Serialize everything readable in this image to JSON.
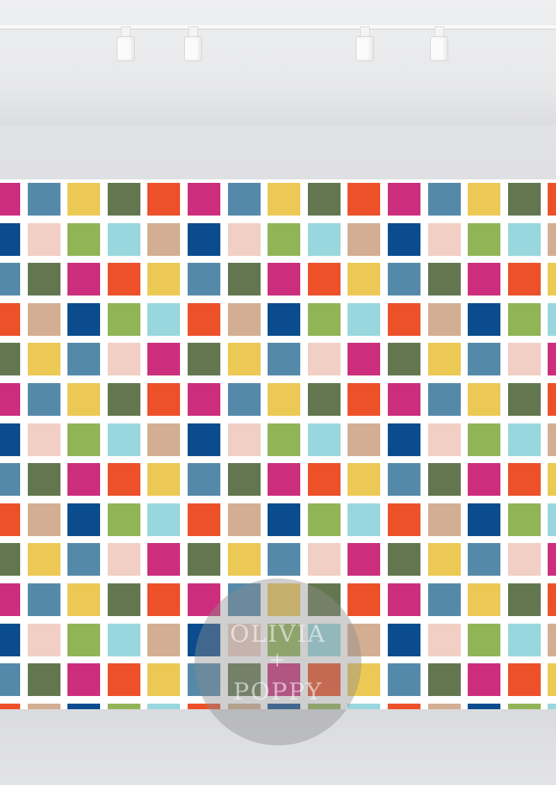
{
  "scene": "gallery-wall-with-wallpaper",
  "colors": {
    "magenta": "#cc2e7d",
    "steel_blue": "#5589aa",
    "yellow": "#ecc955",
    "moss_green": "#62774f",
    "orange": "#ec5129",
    "navy": "#0b4c8f",
    "blush": "#f1cfc4",
    "lime": "#91b457",
    "aqua": "#98d7de",
    "tan": "#d3ae92"
  },
  "pattern": {
    "name": "multicolor-square-grid",
    "rows": [
      [
        "magenta",
        "steel_blue",
        "yellow",
        "moss_green",
        "orange",
        "magenta",
        "steel_blue",
        "yellow",
        "moss_green",
        "orange",
        "magenta",
        "steel_blue",
        "yellow",
        "moss_green",
        "orange"
      ],
      [
        "navy",
        "blush",
        "lime",
        "aqua",
        "tan",
        "navy",
        "blush",
        "lime",
        "aqua",
        "tan",
        "navy",
        "blush",
        "lime",
        "aqua",
        "tan"
      ],
      [
        "steel_blue",
        "moss_green",
        "magenta",
        "orange",
        "yellow",
        "steel_blue",
        "moss_green",
        "magenta",
        "orange",
        "yellow",
        "steel_blue",
        "moss_green",
        "magenta",
        "orange",
        "yellow"
      ],
      [
        "orange",
        "tan",
        "navy",
        "lime",
        "aqua",
        "orange",
        "tan",
        "navy",
        "lime",
        "aqua",
        "orange",
        "tan",
        "navy",
        "lime",
        "aqua"
      ],
      [
        "moss_green",
        "yellow",
        "steel_blue",
        "blush",
        "magenta",
        "moss_green",
        "yellow",
        "steel_blue",
        "blush",
        "magenta",
        "moss_green",
        "yellow",
        "steel_blue",
        "blush",
        "magenta"
      ],
      [
        "magenta",
        "steel_blue",
        "yellow",
        "moss_green",
        "orange",
        "magenta",
        "steel_blue",
        "yellow",
        "moss_green",
        "orange",
        "magenta",
        "steel_blue",
        "yellow",
        "moss_green",
        "orange"
      ],
      [
        "navy",
        "blush",
        "lime",
        "aqua",
        "tan",
        "navy",
        "blush",
        "lime",
        "aqua",
        "tan",
        "navy",
        "blush",
        "lime",
        "aqua",
        "tan"
      ],
      [
        "steel_blue",
        "moss_green",
        "magenta",
        "orange",
        "yellow",
        "steel_blue",
        "moss_green",
        "magenta",
        "orange",
        "yellow",
        "steel_blue",
        "moss_green",
        "magenta",
        "orange",
        "yellow"
      ],
      [
        "orange",
        "tan",
        "navy",
        "lime",
        "aqua",
        "orange",
        "tan",
        "navy",
        "lime",
        "aqua",
        "orange",
        "tan",
        "navy",
        "lime",
        "aqua"
      ],
      [
        "moss_green",
        "yellow",
        "steel_blue",
        "blush",
        "magenta",
        "moss_green",
        "yellow",
        "steel_blue",
        "blush",
        "magenta",
        "moss_green",
        "yellow",
        "steel_blue",
        "blush",
        "magenta"
      ],
      [
        "magenta",
        "steel_blue",
        "yellow",
        "moss_green",
        "orange",
        "magenta",
        "steel_blue",
        "yellow",
        "moss_green",
        "orange",
        "magenta",
        "steel_blue",
        "yellow",
        "moss_green",
        "orange"
      ],
      [
        "navy",
        "blush",
        "lime",
        "aqua",
        "tan",
        "navy",
        "blush",
        "lime",
        "aqua",
        "tan",
        "navy",
        "blush",
        "lime",
        "aqua",
        "tan"
      ],
      [
        "steel_blue",
        "moss_green",
        "magenta",
        "orange",
        "yellow",
        "steel_blue",
        "moss_green",
        "magenta",
        "orange",
        "yellow",
        "steel_blue",
        "moss_green",
        "magenta",
        "orange",
        "yellow"
      ],
      [
        "orange",
        "tan",
        "navy",
        "lime",
        "aqua",
        "orange",
        "tan",
        "navy",
        "lime",
        "aqua",
        "orange",
        "tan",
        "navy",
        "lime",
        "aqua"
      ]
    ]
  },
  "watermark": {
    "line1": "OLIVIA",
    "line2": "+",
    "line3": "POPPY"
  }
}
